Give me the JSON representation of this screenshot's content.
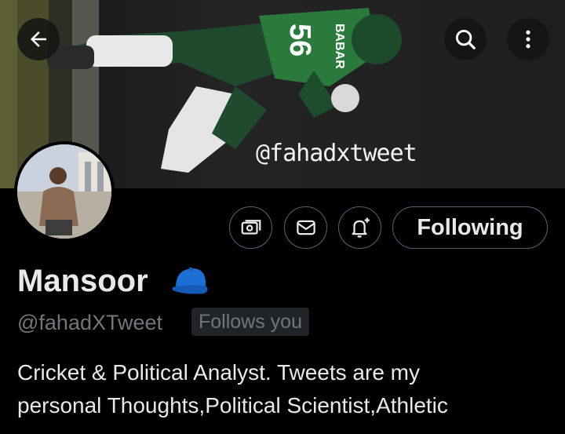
{
  "header": {
    "banner_handle": "@fahadxtweet",
    "jersey_name": "BABAR",
    "jersey_number": "56",
    "back_icon": "arrow-left-icon",
    "search_icon": "search-icon",
    "more_icon": "more-vertical-icon"
  },
  "profile": {
    "name": "Mansoor",
    "name_emoji": "blue-cap-icon",
    "username": "@fahadXTweet",
    "follows_you": "Follows you",
    "bio_line1": "Cricket & Political Analyst. Tweets are my",
    "bio_line2": "personal Thoughts,Political Scientist,Athletic"
  },
  "actions": {
    "following_label": "Following",
    "subscribe_icon": "money-icon",
    "message_icon": "envelope-icon",
    "notify_icon": "bell-plus-icon"
  },
  "colors": {
    "background": "#000000",
    "text": "#e7e9ea",
    "muted": "#71767b",
    "border": "#536471",
    "cap_blue": "#1d6fd6"
  }
}
